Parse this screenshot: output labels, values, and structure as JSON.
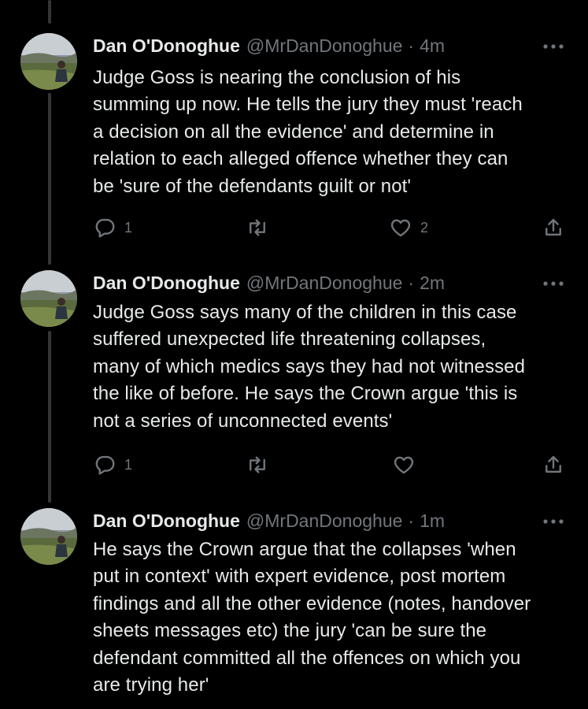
{
  "tweets": [
    {
      "author": "Dan O'Donoghue",
      "handle": "@MrDanDonoghue",
      "separator": "·",
      "time": "4m",
      "lines": [
        "Judge Goss is nearing the conclusion of his",
        "summing up now. He tells the jury they must 'reach",
        "a decision on all the evidence' and determine in",
        "relation to each alleged offence whether they can",
        "be 'sure of the defendants guilt or not'"
      ],
      "replies": "1",
      "reposts": "",
      "likes": "2"
    },
    {
      "author": "Dan O'Donoghue",
      "handle": "@MrDanDonoghue",
      "separator": "·",
      "time": "2m",
      "lines": [
        "Judge Goss says many of the children in this case",
        "suffered unexpected life threatening collapses,",
        "many of which medics says they had not witnessed",
        "the like of before. He says the Crown argue 'this is",
        "not a series of unconnected events'"
      ],
      "replies": "1",
      "reposts": "",
      "likes": ""
    },
    {
      "author": "Dan O'Donoghue",
      "handle": "@MrDanDonoghue",
      "separator": "·",
      "time": "1m",
      "lines": [
        "He says the Crown argue that the collapses 'when",
        "put in context' with expert evidence, post mortem",
        "findings and all the other evidence (notes, handover",
        "sheets messages etc) the jury 'can be sure the",
        "defendant committed all the offences on which you",
        "are trying her'"
      ]
    }
  ],
  "icons": {
    "reply": "reply-icon",
    "repost": "repost-icon",
    "like": "heart-icon",
    "share": "share-icon",
    "more": "more-icon"
  },
  "colors": {
    "background": "#000000",
    "text": "#e7e9ea",
    "secondary": "#71767b",
    "thread_line": "#333639"
  }
}
